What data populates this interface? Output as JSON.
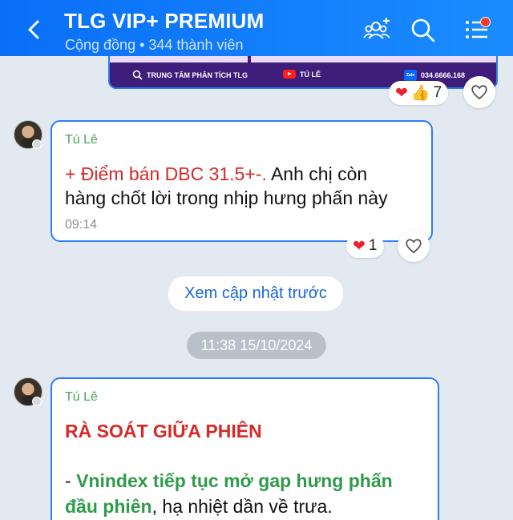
{
  "header": {
    "title": "TLG VIP+ PREMIUM",
    "subtitle": "Cộng đồng • 344 thành viên",
    "back_icon": "chevron-left-icon",
    "group_icon": "add-member-icon",
    "search_icon": "search-icon",
    "menu_icon": "list-menu-icon",
    "accent_color": "#1a8cff"
  },
  "banner": {
    "item1": "TRUNG TÂM PHÂN TÍCH TLG",
    "item2": "TÚ LÊ",
    "item3": "034.6666.168",
    "zalo_text": "Zalo"
  },
  "banner_reactions": {
    "count": "7"
  },
  "messages": [
    {
      "sender": "Tú Lê",
      "line1_red": "+ Điểm bán DBC 31.5+-.",
      "line1_rest": " Anh chị còn",
      "line2": "hàng chốt lời trong nhịp hưng phấn này",
      "time": "09:14",
      "reaction_count": "1"
    },
    {
      "sender": "Tú Lê",
      "heading": "RÀ SOÁT GIỮA PHIÊN",
      "line1_dash": "- ",
      "line1_green": "Vnindex tiếp tục mở gap hưng phấn",
      "line2_green": "đầu phiên",
      "line2_rest": ", hạ nhiệt dần về trưa."
    }
  ],
  "see_more_label": "Xem cập nhật trước",
  "date_separator": "11:38 15/10/2024"
}
